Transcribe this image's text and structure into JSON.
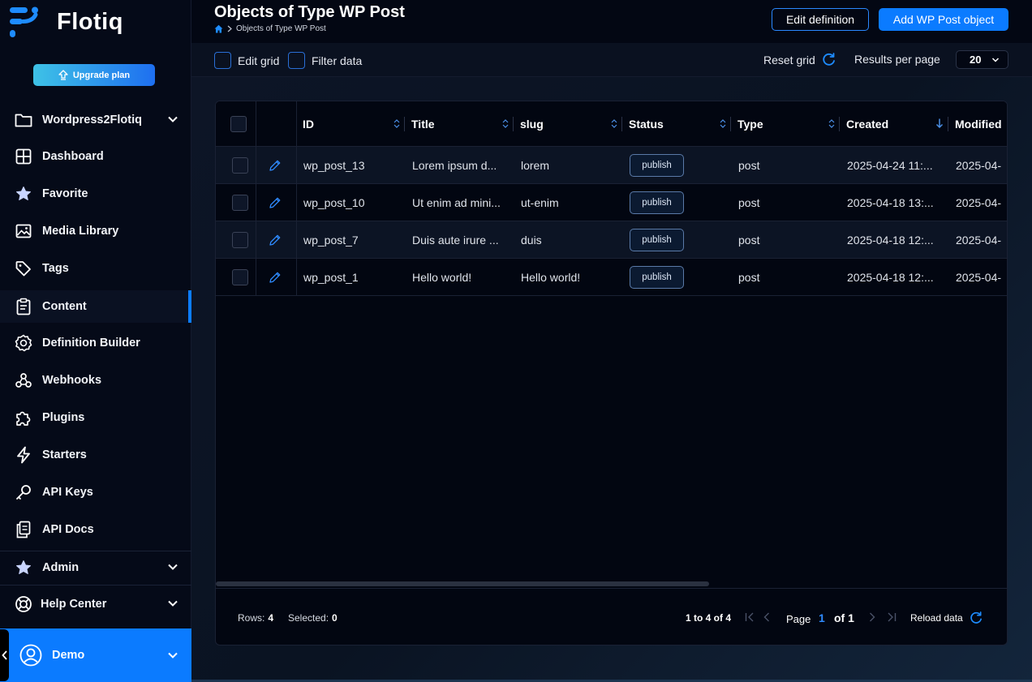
{
  "app": {
    "name": "Flotiq"
  },
  "sidebar": {
    "upgrade_label": "Upgrade plan",
    "items": [
      {
        "label": "Wordpress2Flotiq",
        "icon": "folder-icon"
      },
      {
        "label": "Dashboard",
        "icon": "dashboard-icon"
      },
      {
        "label": "Favorite",
        "icon": "star-icon"
      },
      {
        "label": "Media Library",
        "icon": "image-icon"
      },
      {
        "label": "Tags",
        "icon": "tag-icon"
      },
      {
        "label": "Content",
        "icon": "clipboard-icon"
      },
      {
        "label": "Definition Builder",
        "icon": "gear-icon"
      },
      {
        "label": "Webhooks",
        "icon": "webhook-icon"
      },
      {
        "label": "Plugins",
        "icon": "puzzle-icon"
      },
      {
        "label": "Starters",
        "icon": "lightning-icon"
      },
      {
        "label": "API Keys",
        "icon": "key-icon"
      },
      {
        "label": "API Docs",
        "icon": "docs-icon"
      },
      {
        "label": "Admin",
        "icon": "star-icon"
      },
      {
        "label": "Help Center",
        "icon": "lifebuoy-icon"
      }
    ],
    "active_item": "Content",
    "user": {
      "label": "Demo"
    }
  },
  "header": {
    "title": "Objects of Type WP Post",
    "breadcrumb": "Objects of Type WP Post",
    "edit_definition_label": "Edit definition",
    "add_object_label": "Add WP Post object"
  },
  "toolbar": {
    "edit_grid_label": "Edit grid",
    "filter_data_label": "Filter data",
    "reset_grid_label": "Reset grid",
    "results_per_page_label": "Results per page",
    "results_per_page_value": "20"
  },
  "grid": {
    "columns": [
      "ID",
      "Title",
      "slug",
      "Status",
      "Type",
      "Created",
      "Modified"
    ],
    "rows": [
      {
        "id": "wp_post_13",
        "title": "Lorem ipsum d...",
        "slug": "lorem",
        "status": "publish",
        "type": "post",
        "created": "2025-04-24 11:...",
        "modified": "2025-04-"
      },
      {
        "id": "wp_post_10",
        "title": "Ut enim ad mini...",
        "slug": "ut-enim",
        "status": "publish",
        "type": "post",
        "created": "2025-04-18 13:...",
        "modified": "2025-04-"
      },
      {
        "id": "wp_post_7",
        "title": "Duis aute irure ...",
        "slug": "duis",
        "status": "publish",
        "type": "post",
        "created": "2025-04-18 12:...",
        "modified": "2025-04-"
      },
      {
        "id": "wp_post_1",
        "title": "Hello world!",
        "slug": "Hello world!",
        "status": "publish",
        "type": "post",
        "created": "2025-04-18 12:...",
        "modified": "2025-04-"
      }
    ]
  },
  "footer": {
    "rows_label": "Rows:",
    "rows_value": "4",
    "selected_label": "Selected:",
    "selected_value": "0",
    "range_text": "1 to 4 of 4",
    "page_label": "Page",
    "page_current": "1",
    "page_of": "of 1",
    "reload_label": "Reload data"
  },
  "colors": {
    "accent": "#0b7bff",
    "background": "#030713"
  }
}
